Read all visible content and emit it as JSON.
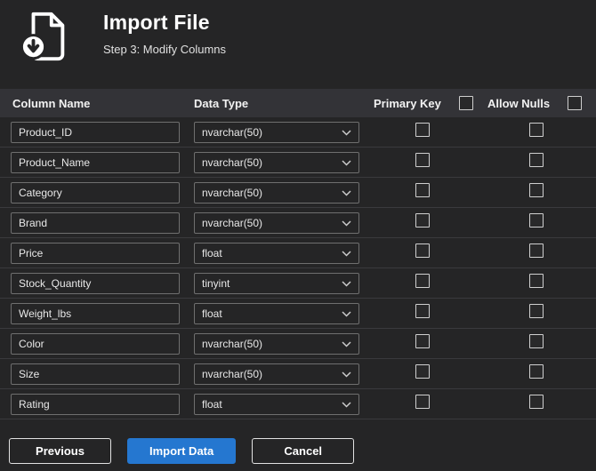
{
  "header": {
    "title": "Import File",
    "subtitle": "Step 3: Modify Columns"
  },
  "table": {
    "headers": {
      "column_name": "Column Name",
      "data_type": "Data Type",
      "primary_key": "Primary Key",
      "allow_nulls": "Allow Nulls"
    },
    "select_all": {
      "primary_key_checked": false,
      "allow_nulls_checked": false
    },
    "rows": [
      {
        "name": "Product_ID",
        "type": "nvarchar(50)",
        "primary_key": false,
        "allow_nulls": false
      },
      {
        "name": "Product_Name",
        "type": "nvarchar(50)",
        "primary_key": false,
        "allow_nulls": false
      },
      {
        "name": "Category",
        "type": "nvarchar(50)",
        "primary_key": false,
        "allow_nulls": false
      },
      {
        "name": "Brand",
        "type": "nvarchar(50)",
        "primary_key": false,
        "allow_nulls": false
      },
      {
        "name": "Price",
        "type": "float",
        "primary_key": false,
        "allow_nulls": false
      },
      {
        "name": "Stock_Quantity",
        "type": "tinyint",
        "primary_key": false,
        "allow_nulls": false
      },
      {
        "name": "Weight_lbs",
        "type": "float",
        "primary_key": false,
        "allow_nulls": false
      },
      {
        "name": "Color",
        "type": "nvarchar(50)",
        "primary_key": false,
        "allow_nulls": false
      },
      {
        "name": "Size",
        "type": "nvarchar(50)",
        "primary_key": false,
        "allow_nulls": false
      },
      {
        "name": "Rating",
        "type": "float",
        "primary_key": false,
        "allow_nulls": false
      }
    ]
  },
  "footer": {
    "previous_label": "Previous",
    "import_label": "Import Data",
    "cancel_label": "Cancel"
  },
  "colors": {
    "background": "#252526",
    "header_strip": "#333337",
    "accent": "#2577d0",
    "border": "#6f6f6f"
  }
}
